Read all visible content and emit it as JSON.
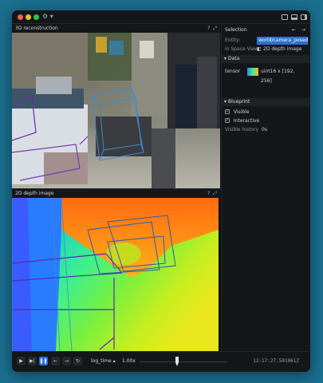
{
  "app": {
    "menu_icon": "⚙ ▾"
  },
  "views": {
    "top_title": "3D reconstruction",
    "bottom_title": "2D depth image",
    "help_glyph": "?",
    "max_glyph": "⤢"
  },
  "selection": {
    "title": "Selection",
    "entity_label": "Entity:",
    "entity_value": "world/camera_posed_low...",
    "space_view_label": "in Space View:",
    "space_view_value": "2D depth image",
    "data_section": "Data",
    "tensor_label": "tensor",
    "tensor_value": "uint16 x [192, 256]",
    "blueprint_section": "Blueprint",
    "visible_label": "Visible",
    "interactive_label": "Interactive",
    "visible_history_label": "Visible history",
    "visible_history_value": "0s"
  },
  "timeline": {
    "timeline_name": "log_time",
    "speed": "1.00x",
    "timestamp": "12:17:27.501061Z",
    "icons": [
      "play",
      "step",
      "pause",
      "prev",
      "next",
      "loop"
    ]
  },
  "colors": {
    "accent": "#2c6fd6",
    "window_bg": "#0d1012",
    "desktop": "#1b6f8f"
  }
}
